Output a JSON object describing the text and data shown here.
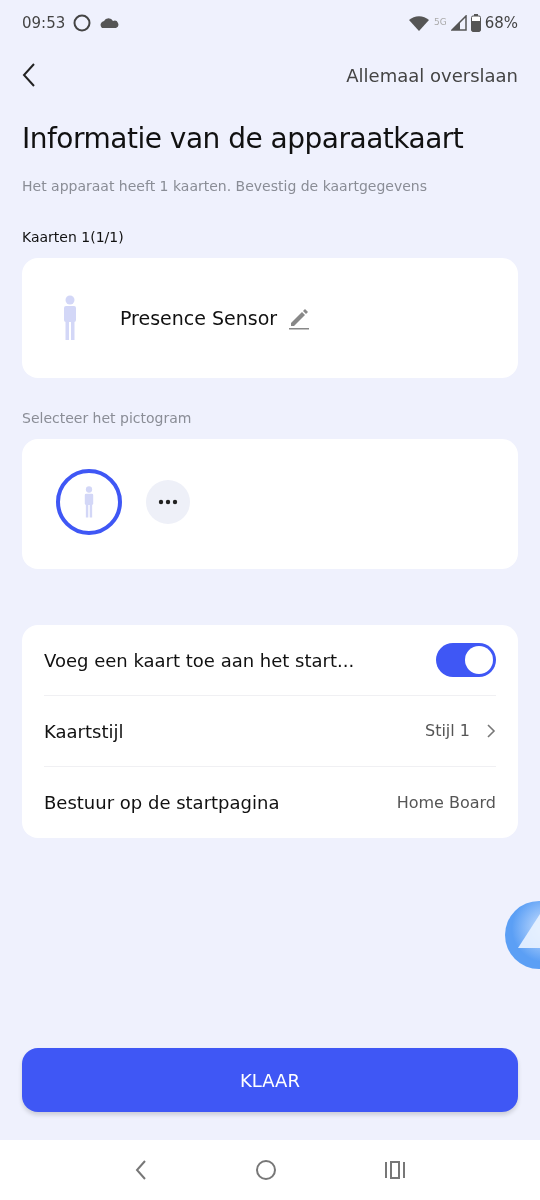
{
  "status_bar": {
    "time": "09:53",
    "network": "5G",
    "battery": "68%"
  },
  "header": {
    "skip_label": "Allemaal overslaan"
  },
  "title": "Informatie van de apparaatkaart",
  "subtitle": "Het apparaat heeft 1 kaarten. Bevestig de kaartgegevens",
  "cards_label": "Kaarten 1(1/1)",
  "card": {
    "name": "Presence Sensor"
  },
  "icon_label": "Selecteer het pictogram",
  "icons": [
    {
      "kind": "person",
      "selected": true
    },
    {
      "kind": "more",
      "selected": false
    }
  ],
  "settings": [
    {
      "kind": "toggle",
      "label": "Voeg een kaart toe aan het start...",
      "on": true
    },
    {
      "kind": "link",
      "label": "Kaartstijl",
      "value": "Stijl 1"
    },
    {
      "kind": "value",
      "label": "Bestuur op de startpagina",
      "value": "Home Board"
    }
  ],
  "done_button": "KLAAR"
}
